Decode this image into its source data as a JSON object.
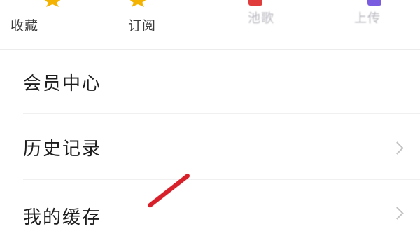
{
  "quick_actions": [
    {
      "label": "收藏",
      "icon": "star-icon",
      "color": "#f5b301"
    },
    {
      "label": "订阅",
      "icon": "star-icon",
      "color": "#f5b301"
    },
    {
      "label": "池歌",
      "icon": "red-square-icon",
      "color": "#e03c3c"
    },
    {
      "label": "上传",
      "icon": "purple-square-icon",
      "color": "#7a5ce0"
    }
  ],
  "menu": {
    "items": [
      {
        "label": "会员中心",
        "has_chevron": false
      },
      {
        "label": "历史记录",
        "has_chevron": true
      },
      {
        "label": "我的缓存",
        "has_chevron": true
      }
    ]
  },
  "annotation": {
    "color": "#d8202a"
  }
}
